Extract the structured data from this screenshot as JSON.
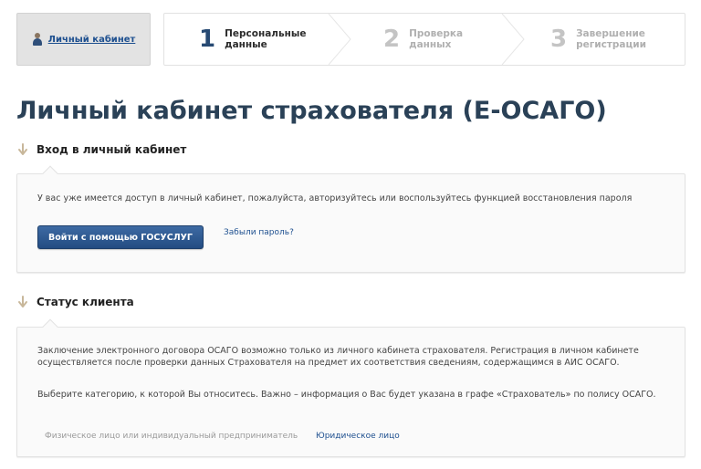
{
  "header": {
    "cabinet_link": "Личный кабинет",
    "steps": [
      {
        "number": "1",
        "label_line1": "Персональные",
        "label_line2": "данные",
        "state": "active"
      },
      {
        "number": "2",
        "label_line1": "Проверка",
        "label_line2": "данных",
        "state": "inactive"
      },
      {
        "number": "3",
        "label_line1": "Завершение",
        "label_line2": "регистрации",
        "state": "inactive"
      }
    ]
  },
  "page_title": "Личный кабинет страхователя (Е-ОСАГО)",
  "login_section": {
    "title": "Вход в личный кабинет",
    "text": "У вас уже имеется доступ в личный кабинет, пожалуйста, авторизуйтесь или воспользуйтесь функцией восстановления пароля",
    "gosuslugi_button": "Войти с помощью ГОСУСЛУГ",
    "forgot_password": "Забыли пароль?"
  },
  "status_section": {
    "title": "Статус клиента",
    "text1": "Заключение электронного договора ОСАГО возможно только из личного кабинета страхователя. Регистрация в личном кабинете осуществляется после проверки данных Страхователя на предмет их соответствия сведениям, содержащимся в АИС ОСАГО.",
    "text2": "Выберите категорию, к которой Вы относитесь. Важно – информация о Вас будет указана в графе «Страхователь» по полису ОСАГО.",
    "category_physical": "Физическое лицо или индивидуальный предприниматель",
    "category_juridical": "Юридическое лицо"
  },
  "colors": {
    "accent": "#1d4f8f",
    "button": "#2a5288",
    "title": "#2a4157",
    "arrow": "#c8b79a"
  }
}
